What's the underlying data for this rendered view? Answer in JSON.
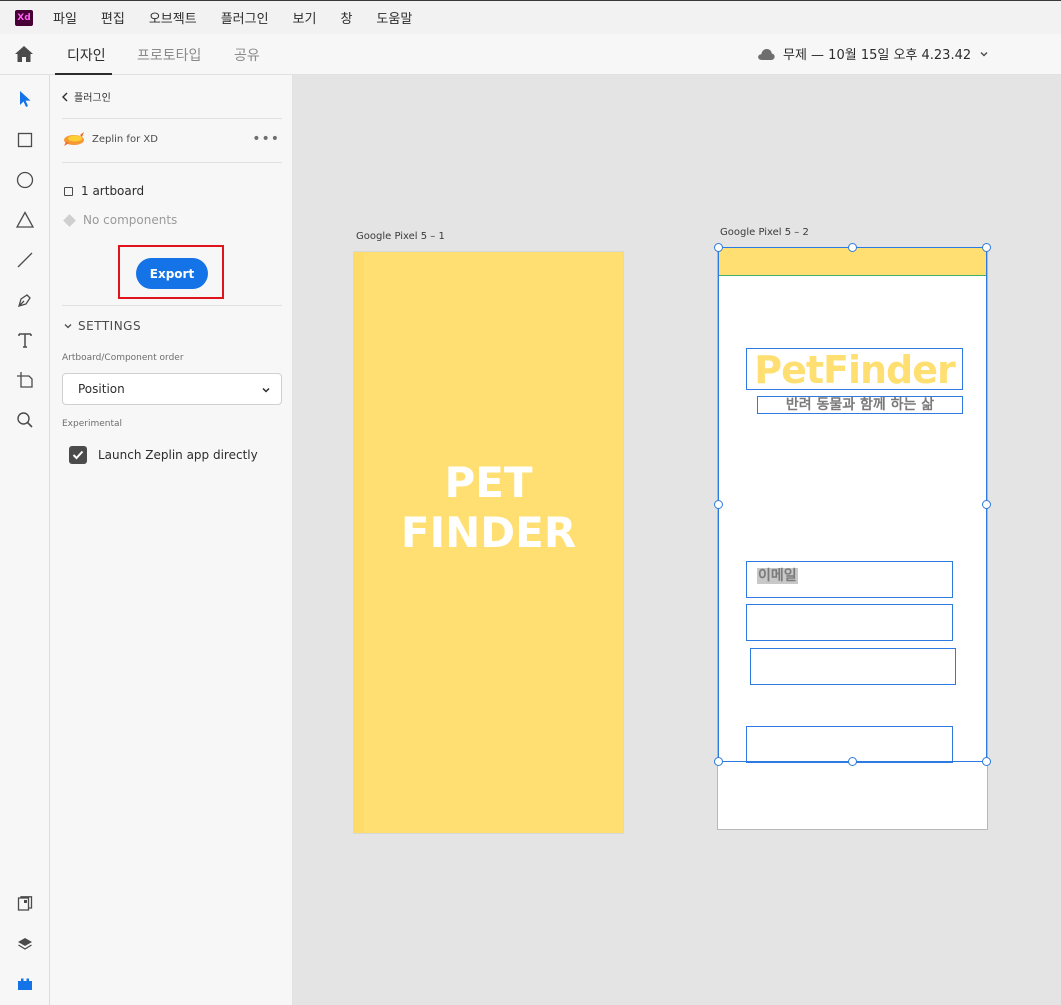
{
  "app": {
    "logo": "Xd"
  },
  "menu": {
    "items": [
      "파일",
      "편집",
      "오브젝트",
      "플러그인",
      "보기",
      "창",
      "도움말"
    ]
  },
  "tabs": [
    {
      "label": "디자인",
      "active": true
    },
    {
      "label": "프로토타입",
      "active": false
    },
    {
      "label": "공유",
      "active": false
    }
  ],
  "document": {
    "status": "무제 — 10월 15일 오후 4.23.42",
    "icon": "cloud-icon"
  },
  "panel": {
    "back_label": "플러그인",
    "plugin_name": "Zeplin for XD",
    "more_label": "•••",
    "artboards": "1 artboard",
    "components": "No components",
    "export_label": "Export",
    "settings_label": "SETTINGS",
    "order_label": "Artboard/Component order",
    "order_value": "Position",
    "experimental_label": "Experimental",
    "launch_label": "Launch Zeplin app directly",
    "launch_checked": true
  },
  "canvas": {
    "artboard1": {
      "label": "Google Pixel 5 – 1",
      "title_line1": "PET",
      "title_line2": "FINDER",
      "color": "#ffdf71"
    },
    "artboard2": {
      "label": "Google Pixel 5 – 2",
      "app_title": "PetFinder",
      "app_subtitle": "반려 동물과 함께 하는 삶",
      "email_placeholder": "이메일"
    }
  },
  "colors": {
    "accent": "#1473e6",
    "highlight": "#e0151b",
    "selection": "#2d7be0",
    "brand_yellow": "#ffdf71"
  }
}
